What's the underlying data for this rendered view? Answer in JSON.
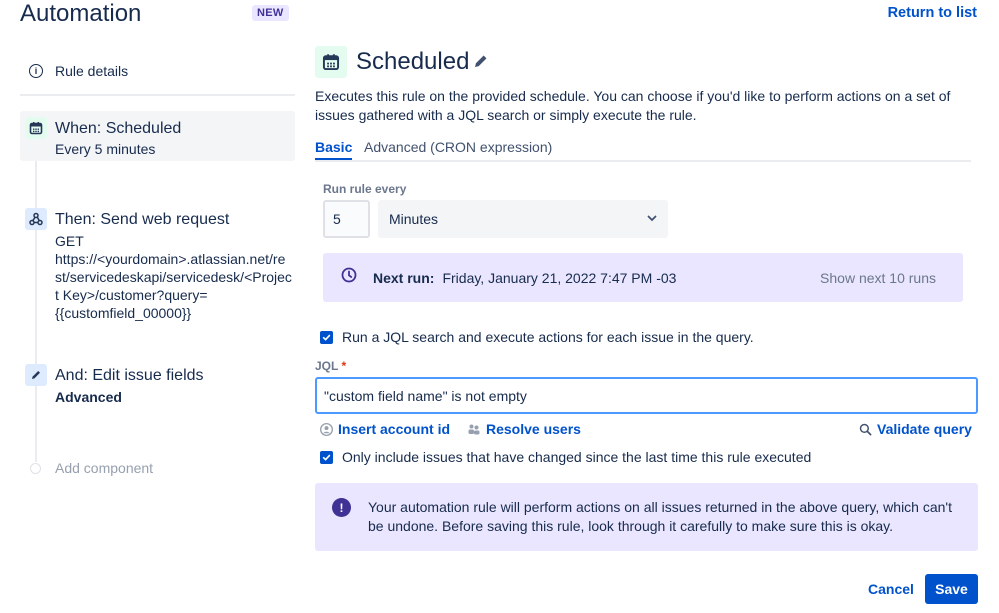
{
  "header": {
    "title": "Automation",
    "badge": "NEW",
    "return_link": "Return to list"
  },
  "sidebar": {
    "rule_details": "Rule details",
    "steps": [
      {
        "title": "When: Scheduled",
        "subtitle": "Every 5 minutes",
        "icon": "calendar-icon",
        "active": true
      },
      {
        "title": "Then: Send web request",
        "subtitle_lines": [
          "GET",
          "https://<yourdomain>.atlassian.net/re",
          "st/servicedeskapi/servicedesk/<Projec",
          "t Key>/customer?query=",
          "{{customfield_00000}}"
        ],
        "icon": "webhook-icon"
      },
      {
        "title": "And: Edit issue fields",
        "subtitle": "Advanced",
        "icon": "pencil-icon"
      }
    ],
    "add_component": "Add component"
  },
  "main": {
    "title": "Scheduled",
    "description": "Executes this rule on the provided schedule. You can choose if you'd like to perform actions on a set of issues gathered with a JQL search or simply execute the rule.",
    "tabs": [
      {
        "label": "Basic",
        "active": true
      },
      {
        "label": "Advanced (CRON expression)",
        "active": false
      }
    ],
    "run_every_label": "Run rule every",
    "run_every_value": "5",
    "run_every_unit": "Minutes",
    "next_run_label": "Next run:",
    "next_run_value": "Friday, January 21, 2022 7:47 PM -03",
    "show_next_runs": "Show next 10 runs",
    "jql_checkbox_label": "Run a JQL search and execute actions for each issue in the query.",
    "jql_checkbox_checked": true,
    "jql_label": "JQL",
    "jql_required_mark": "*",
    "jql_value": "\"custom field name\" is not empty",
    "insert_account_id": "Insert account id",
    "resolve_users": "Resolve users",
    "validate_query": "Validate query",
    "only_changed_label": "Only include issues that have changed since the last time this rule executed",
    "only_changed_checked": true,
    "warning_text": "Your automation rule will perform actions on all issues returned in the above query, which can't be undone. Before saving this rule, look through it carefully to make sure this is okay.",
    "cancel": "Cancel",
    "save": "Save"
  },
  "colors": {
    "primary": "#0052CC",
    "text": "#172B4D",
    "purple_bg": "#EAE6FF",
    "purple_dark": "#403294",
    "green_bg": "#E3FCEF"
  }
}
